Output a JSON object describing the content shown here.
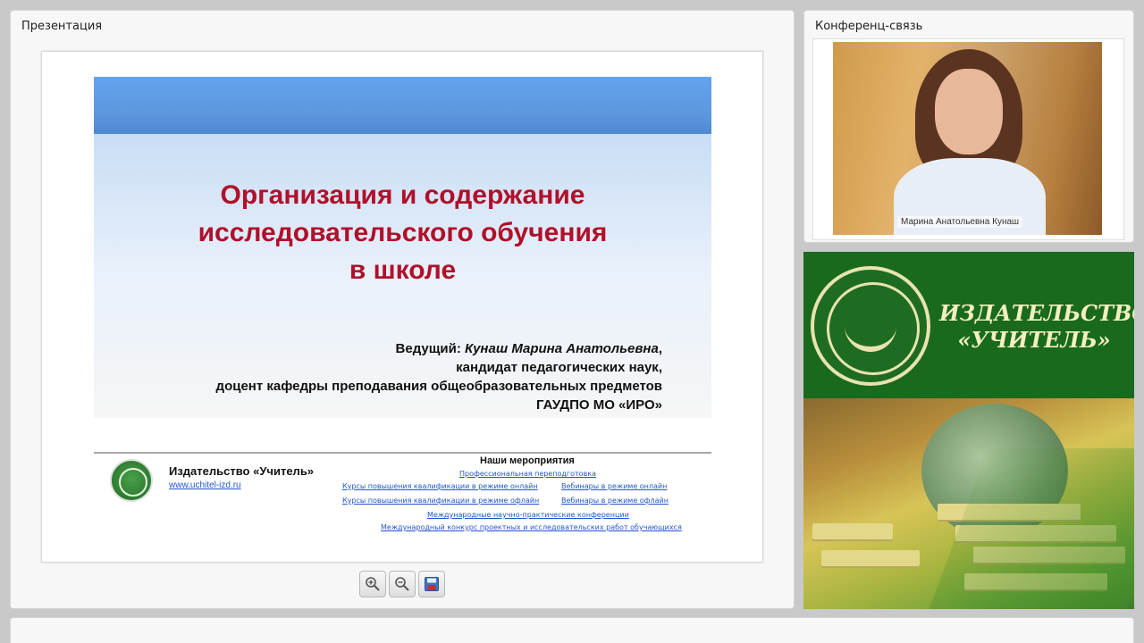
{
  "presentation": {
    "title": "Презентация",
    "slide": {
      "title_lines": [
        "Организация и содержание",
        "исследовательского обучения",
        "в школе"
      ],
      "presenter_label": "Ведущий:",
      "presenter_name": "Кунаш Марина Анатольевна",
      "presenter_comma": ",",
      "presenter_degree": "кандидат педагогических наук,",
      "presenter_position": "доцент кафедры преподавания общеобразовательных предметов",
      "presenter_org": "ГАУДПО МО «ИРО»",
      "publisher_name": "Издательство «Учитель»",
      "publisher_url": "www.uchitel-izd.ru",
      "events_title": "Наши мероприятия",
      "events": [
        "Профессиональная переподготовка",
        "Курсы повышения квалификации в режиме онлайн",
        "Вебинары в режиме онлайн",
        "Курсы повышения квалификации в режиме офлайн",
        "Вебинары в режиме офлайн",
        "Международные научно-практические конференции",
        "Международный конкурс проектных и исследовательских работ обучающихся"
      ]
    },
    "toolbar": {
      "zoom_in": "zoom-in-icon",
      "zoom_out": "zoom-out-icon",
      "save": "save-icon"
    }
  },
  "conference": {
    "title": "Конференц-связь",
    "participant_name": "Марина Анатольевна Кунаш"
  },
  "banner": {
    "line1": "ИЗДАТЕЛЬСТВО",
    "line2": "«УЧИТЕЛЬ»"
  },
  "colors": {
    "slide_title": "#b0102a",
    "slide_header": "#5d98e0",
    "banner_green": "#196a1d",
    "link": "#2255cc"
  }
}
